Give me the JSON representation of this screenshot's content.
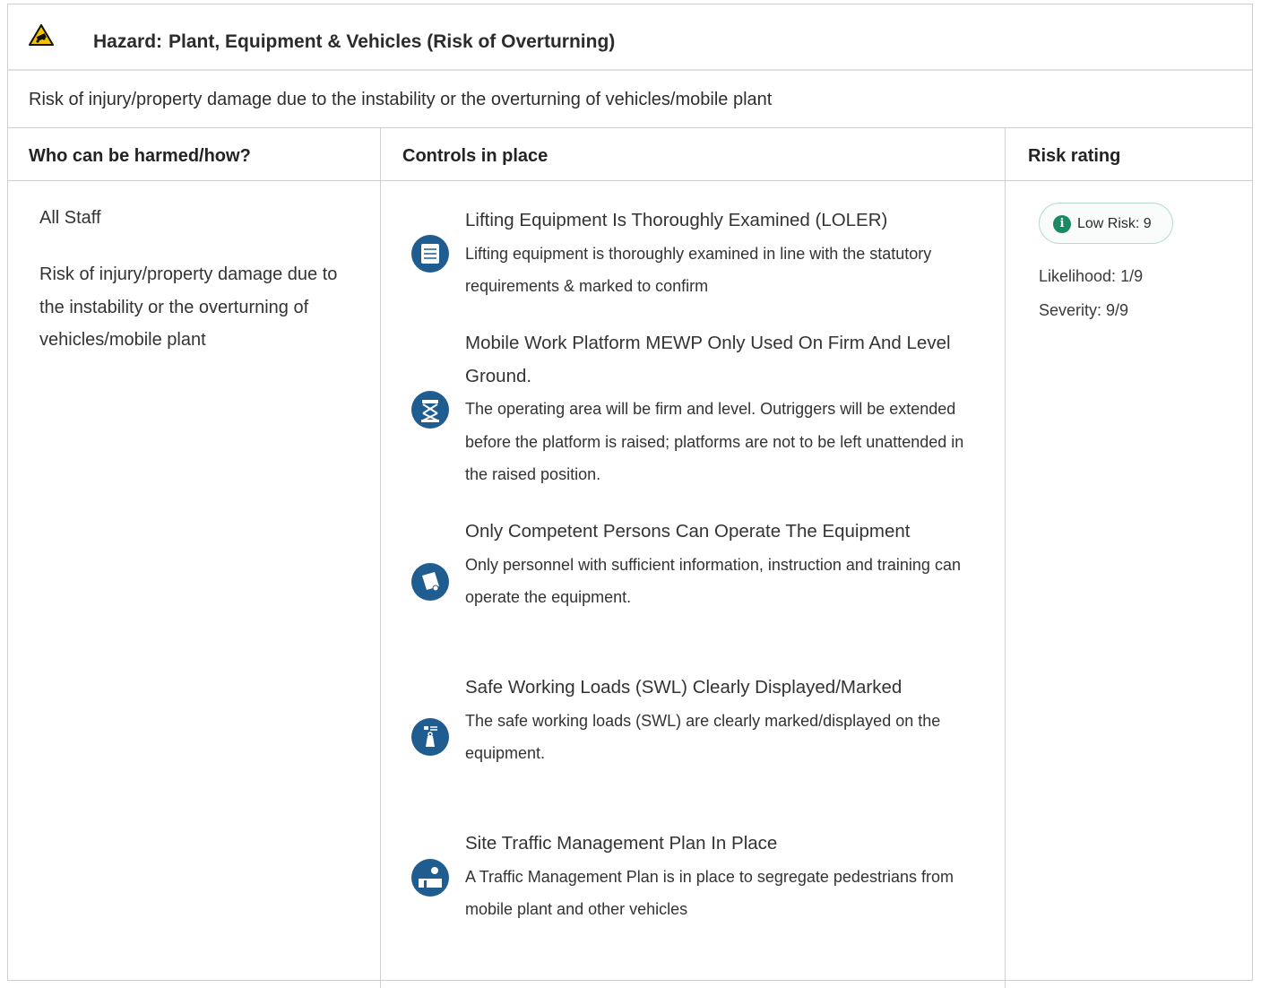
{
  "hazard": {
    "label": "Hazard:",
    "title": "Plant, Equipment & Vehicles (Risk of Overturning)",
    "description": "Risk of injury/property damage due to the instability or the overturning of vehicles/mobile plant",
    "icon": "warning-overturning-vehicle-icon",
    "accent_color": "#f2c300"
  },
  "columns": {
    "who": "Who can be harmed/how?",
    "controls": "Controls in place",
    "risk": "Risk rating"
  },
  "who": {
    "name": "All Staff",
    "description": "Risk of injury/property damage due to the instability or the overturning of vehicles/mobile plant"
  },
  "controls": [
    {
      "title": "Lifting Equipment Is Thoroughly Examined (LOLER)",
      "description": "Lifting equipment is thoroughly examined in line with the statutory requirements & marked to confirm",
      "icon": "calendar-inspection-icon"
    },
    {
      "title": "Mobile Work Platform MEWP Only Used On Firm And Level Ground.",
      "description": "The operating area will be firm and level. Outriggers will be extended before the platform is raised; platforms are not to be left unattended in the raised position.",
      "icon": "scissor-lift-icon"
    },
    {
      "title": "Only Competent Persons Can Operate The Equipment",
      "description": "Only personnel with sufficient information, instruction and training can operate the equipment.",
      "icon": "certificate-icon"
    },
    {
      "title": "Safe Working Loads (SWL) Clearly Displayed/Marked",
      "description": "The safe working loads (SWL) are clearly marked/displayed on the equipment.",
      "icon": "load-weight-icon"
    },
    {
      "title": "Site Traffic Management Plan In Place",
      "description": "A Traffic Management Plan is in place to segregate pedestrians from mobile plant and other vehicles",
      "icon": "traffic-plan-icon"
    }
  ],
  "risk": {
    "badge": "Low Risk: 9",
    "badge_color": "#1a8a63",
    "likelihood": "Likelihood: 1/9",
    "severity": "Severity: 9/9"
  },
  "icon_color": "#1f5c8f"
}
